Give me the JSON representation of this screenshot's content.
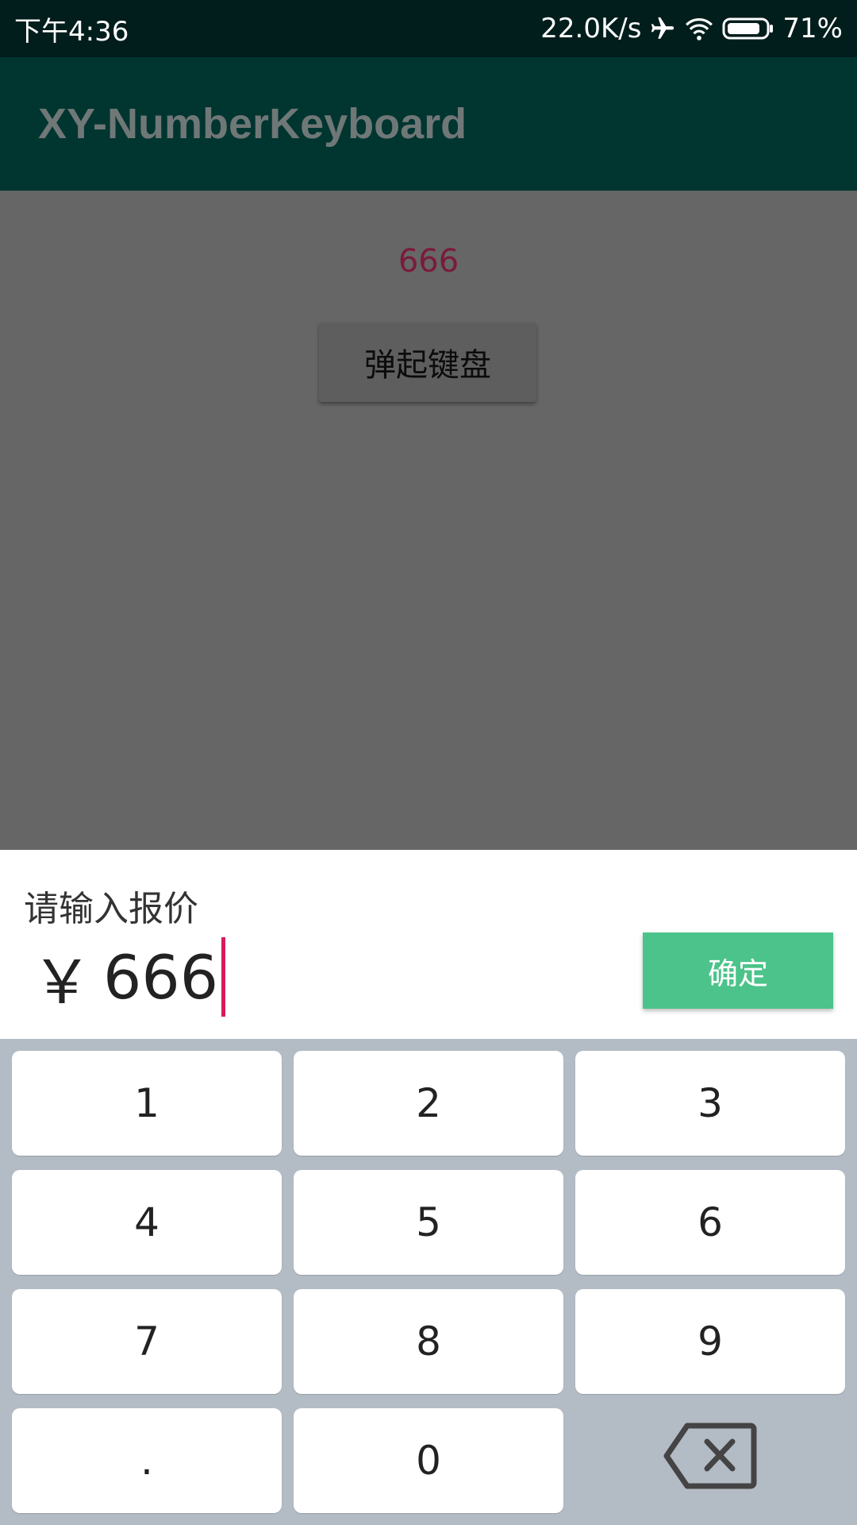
{
  "status_bar": {
    "time": "下午4:36",
    "network_speed": "22.0K/s",
    "battery": "71%",
    "icons": [
      "airplane-icon",
      "wifi-icon",
      "battery-icon"
    ]
  },
  "app_bar": {
    "title": "XY-NumberKeyboard"
  },
  "main": {
    "value": "666",
    "popup_button_label": "弹起键盘"
  },
  "input_panel": {
    "prompt": "请输入报价",
    "currency": "￥",
    "amount": "666",
    "confirm_label": "确定"
  },
  "keyboard": {
    "keys": [
      "1",
      "2",
      "3",
      "4",
      "5",
      "6",
      "7",
      "8",
      "9",
      ".",
      "0"
    ],
    "delete_icon": "backspace-icon"
  },
  "colors": {
    "status_bar_bg": "#021e1c",
    "app_bar_bg": "#003530",
    "accent_red": "#d81b60",
    "confirm_green": "#4cc38a",
    "keyboard_bg": "#b3bbc5"
  }
}
